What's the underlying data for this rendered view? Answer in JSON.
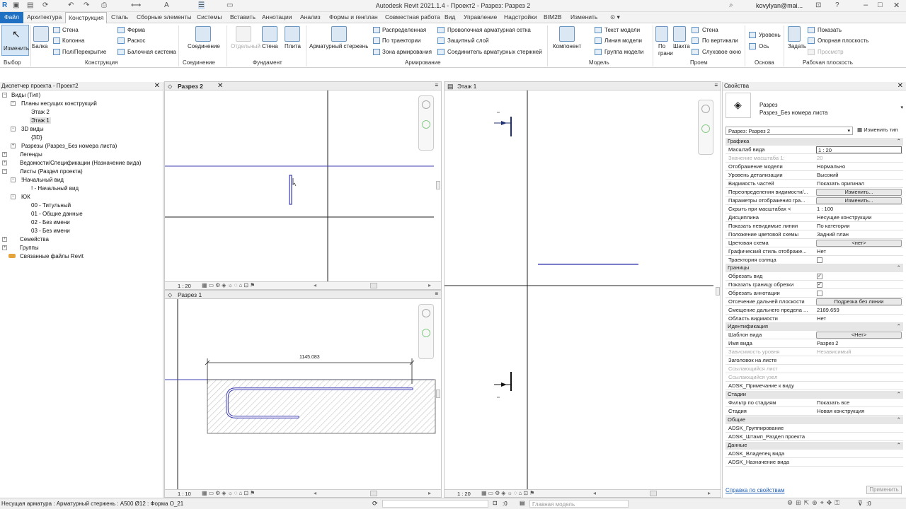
{
  "titlebar": {
    "title": "Autodesk Revit 2021.1.4 - Проект2 - Разрез: Разрез 2",
    "user": "kovylyan@mai..."
  },
  "tabs": [
    "Файл",
    "Архитектура",
    "Конструкция",
    "Сталь",
    "Сборные элементы",
    "Системы",
    "Вставить",
    "Аннотации",
    "Анализ",
    "Формы и генплан",
    "Совместная работа",
    "Вид",
    "Управление",
    "Надстройки",
    "BIM2B",
    "Изменить"
  ],
  "ribbon": {
    "modify": "Изменить",
    "beam": "Балка",
    "wall": "Стена",
    "column": "Колонна",
    "floor": "Пол/Перекрытие",
    "truss": "Ферма",
    "brace": "Раскос",
    "beam_system": "Балочная система",
    "connection": "Соединение",
    "isolated": "Отдельный",
    "f_wall": "Стена",
    "slab": "Плита",
    "rebar": "Арматурный стержень",
    "distributed": "Распределенная",
    "path": "По траектории",
    "area": "Зона армирования",
    "fabric_sheet": "Проволочная арматурная сетка",
    "cover": "Защитный слой",
    "coupler": "Соединитель арматурных стержней",
    "component": "Компонент",
    "model_text": "Текст модели",
    "model_line": "Линия модели",
    "model_group": "Группа модели",
    "by_face": "По грани",
    "shaft": "Шахта",
    "o_wall": "Стена",
    "vertical": "По вертикали",
    "dormer": "Слуховое окно",
    "level": "Уровень",
    "grid": "Ось",
    "set": "Задать",
    "show": "Показать",
    "ref_plane": "Опорная плоскость",
    "viewer": "Просмотр",
    "groups": [
      "Выбор",
      "Конструкция",
      "Соединение",
      "Фундамент",
      "Армирование",
      "Модель",
      "Проем",
      "Основа",
      "Рабочая плоскость"
    ]
  },
  "browser": {
    "title": "Диспетчер проекта - Проект2",
    "items": [
      "Виды (Тип)",
      "Планы несущих конструкций",
      "Этаж 2",
      "Этаж 1",
      "3D виды",
      "{3D}",
      "Разрезы (Разрез_Без номера листа)",
      "Легенды",
      "Ведомости/Спецификации (Назначение вида)",
      "Листы (Раздел проекта)",
      "!Начальный вид",
      "! - Начальный вид",
      "ЮК",
      "00 - Титульный",
      "01 - Общие данные",
      "02 - Без имени",
      "03 - Без имени",
      "Семейства",
      "Группы",
      "Связанные файлы Revit"
    ]
  },
  "views": {
    "v1": {
      "tab": "Разрез 2",
      "scale": "1 : 20"
    },
    "v2": {
      "tab": "Разрез 1",
      "scale": "1 : 10",
      "dimension": "1145.083"
    },
    "v3": {
      "tab": "Этаж 1",
      "scale": "1 : 20"
    }
  },
  "props": {
    "title": "Свойства",
    "family": "Разрез",
    "type": "Разрез_Без номера листа",
    "selector": "Разрез: Разрез 2",
    "edit_type": "Изменить тип",
    "sections": [
      "Графика",
      "Границы",
      "Идентификация",
      "Стадии",
      "Общие",
      "Данные"
    ],
    "graphics": [
      [
        "Масштаб вида",
        "1 : 20"
      ],
      [
        "Значение масштаба    1:",
        "20"
      ],
      [
        "Отображение модели",
        "Нормально"
      ],
      [
        "Уровень детализации",
        "Высокий"
      ],
      [
        "Видимость частей",
        "Показать оригинал"
      ],
      [
        "Переопределения видимости/...",
        "Изменить..."
      ],
      [
        "Параметры отображения гра...",
        "Изменить..."
      ],
      [
        "Скрыть при масштабах <",
        "1 : 100"
      ],
      [
        "Дисциплина",
        "Несущие конструкции"
      ],
      [
        "Показать невидимые линии",
        "По категории"
      ],
      [
        "Положение цветовой схемы",
        "Задний план"
      ],
      [
        "Цветовая схема",
        "<нет>"
      ],
      [
        "Графический стиль отображе...",
        "Нет"
      ],
      [
        "Траектория солнца",
        ""
      ]
    ],
    "bounds": [
      [
        "Обрезать вид",
        ""
      ],
      [
        "Показать границу обрезки",
        ""
      ],
      [
        "Обрезать аннотации",
        ""
      ],
      [
        "Отсечение дальней плоскости",
        "Подрезка без линии"
      ],
      [
        "Смещение дальнего предела ...",
        "2189.659"
      ],
      [
        "Область видимости",
        "Нет"
      ]
    ],
    "ident": [
      [
        "Шаблон вида",
        "<Нет>"
      ],
      [
        "Имя вида",
        "Разрез 2"
      ],
      [
        "Зависимость уровня",
        "Независимый"
      ],
      [
        "Заголовок на листе",
        ""
      ],
      [
        "Ссылающийся лист",
        ""
      ],
      [
        "Ссылающийся узел",
        ""
      ],
      [
        "ADSK_Примечание к виду",
        ""
      ]
    ],
    "phases": [
      [
        "Фильтр по стадиям",
        "Показать все"
      ],
      [
        "Стадия",
        "Новая конструкция"
      ]
    ],
    "common": [
      [
        "ADSK_Группирование",
        ""
      ],
      [
        "ADSK_Штамп_Раздел проекта",
        ""
      ]
    ],
    "data": [
      [
        "ADSK_Владелец вида",
        ""
      ],
      [
        "ADSK_Назначение вида",
        ""
      ]
    ],
    "help": "Справка по свойствам",
    "apply": "Применить"
  },
  "status": {
    "text": "Несущая арматура : Арматурный стержень : A500 Ø12 : Форма О_21",
    "coord": ":0",
    "model": "Главная модель",
    "filter": ":0"
  }
}
